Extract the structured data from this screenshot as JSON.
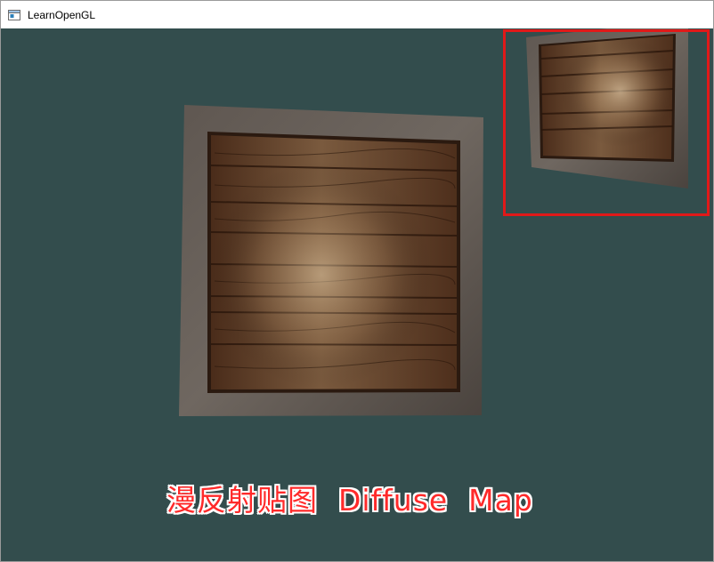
{
  "window": {
    "title": "LearnOpenGL",
    "icon": "window-app-icon"
  },
  "scene": {
    "clear_color": "#334d4d",
    "caption": "漫反射贴图  Diffuse  Map",
    "caption_color": "#ff2a2a",
    "highlight_color": "#e11919"
  }
}
